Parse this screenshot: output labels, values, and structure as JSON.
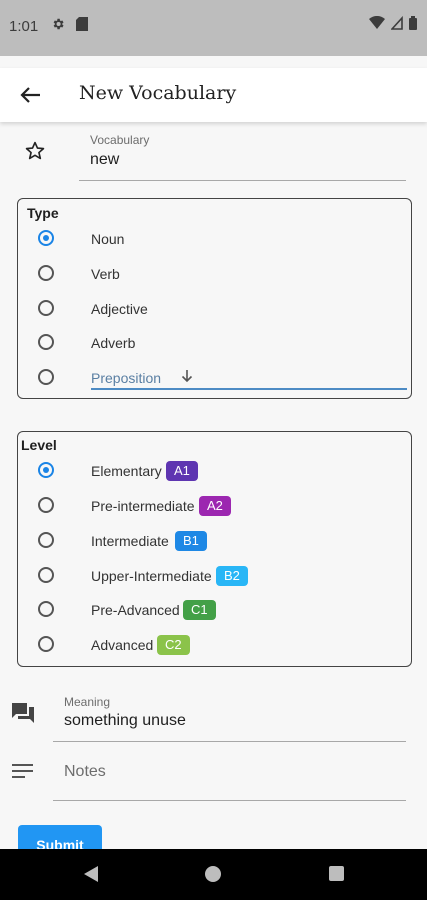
{
  "status": {
    "time": "1:01"
  },
  "app_bar": {
    "title": "New Vocabulary"
  },
  "vocabulary": {
    "label": "Vocabulary",
    "value": "new"
  },
  "type_group": {
    "title": "Type",
    "options": [
      "Noun",
      "Verb",
      "Adjective",
      "Adverb",
      "Preposition"
    ],
    "selected": "Noun"
  },
  "level_group": {
    "title": "Level",
    "options": [
      {
        "label": "Elementary",
        "badge": "A1",
        "color": "#5e35b1"
      },
      {
        "label": "Pre-intermediate",
        "badge": "A2",
        "color": "#9c27b0"
      },
      {
        "label": "Intermediate",
        "badge": "B1",
        "color": "#1e88e5"
      },
      {
        "label": "Upper-Intermediate",
        "badge": "B2",
        "color": "#29b6f6"
      },
      {
        "label": "Pre-Advanced",
        "badge": "C1",
        "color": "#43a047"
      },
      {
        "label": "Advanced",
        "badge": "C2",
        "color": "#8bc34a"
      }
    ],
    "selected": "Elementary"
  },
  "meaning": {
    "label": "Meaning",
    "value": "something unuse"
  },
  "notes": {
    "placeholder": "Notes"
  },
  "submit": {
    "label": "Submit"
  },
  "icons": {
    "star": "star-outline-icon",
    "meaning": "forum-icon",
    "notes": "notes-lines-icon",
    "back": "arrow-back-icon",
    "dropdown": "arrow-down-icon"
  },
  "colors": {
    "accent": "#1a84e6",
    "submit": "#2196f3"
  }
}
